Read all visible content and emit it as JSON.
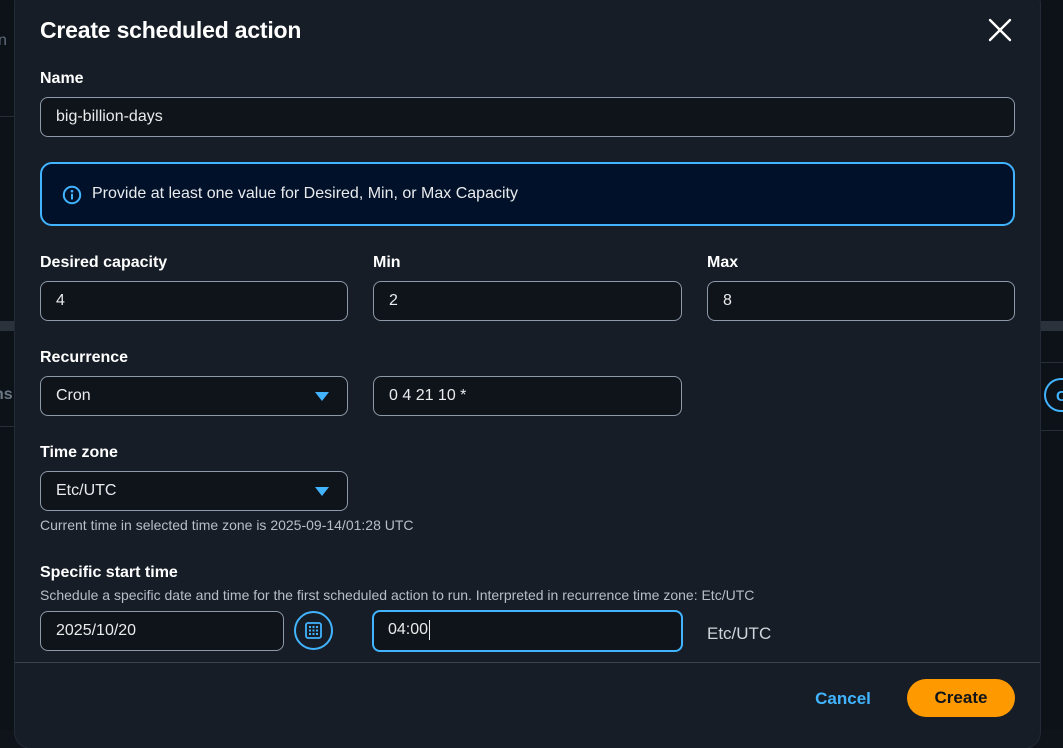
{
  "background": {
    "frag_top": "n",
    "frag_mid": "ns",
    "frag_btn": "Cr"
  },
  "dialog": {
    "title": "Create scheduled action",
    "close_icon": "close-icon"
  },
  "name": {
    "label": "Name",
    "value": "big-billion-days"
  },
  "alert": {
    "icon": "info-icon",
    "text": "Provide at least one value for Desired, Min, or Max Capacity",
    "color": "#42b4ff"
  },
  "capacity": {
    "desired_label": "Desired capacity",
    "desired_value": "4",
    "min_label": "Min",
    "min_value": "2",
    "max_label": "Max",
    "max_value": "8"
  },
  "recurrence": {
    "label": "Recurrence",
    "type_value": "Cron",
    "expression_value": "0 4 21 10 *"
  },
  "timezone": {
    "label": "Time zone",
    "value": "Etc/UTC",
    "hint": "Current time in selected time zone is 2025-09-14/01:28 UTC"
  },
  "start_time": {
    "label": "Specific start time",
    "description": "Schedule a specific date and time for the first scheduled action to run. Interpreted in recurrence time zone: Etc/UTC",
    "date_value": "2025/10/20",
    "calendar_icon": "calendar-icon",
    "time_value": "04:00",
    "tz_suffix": "Etc/UTC"
  },
  "footer": {
    "cancel_label": "Cancel",
    "create_label": "Create",
    "accent": "#ff9900"
  }
}
